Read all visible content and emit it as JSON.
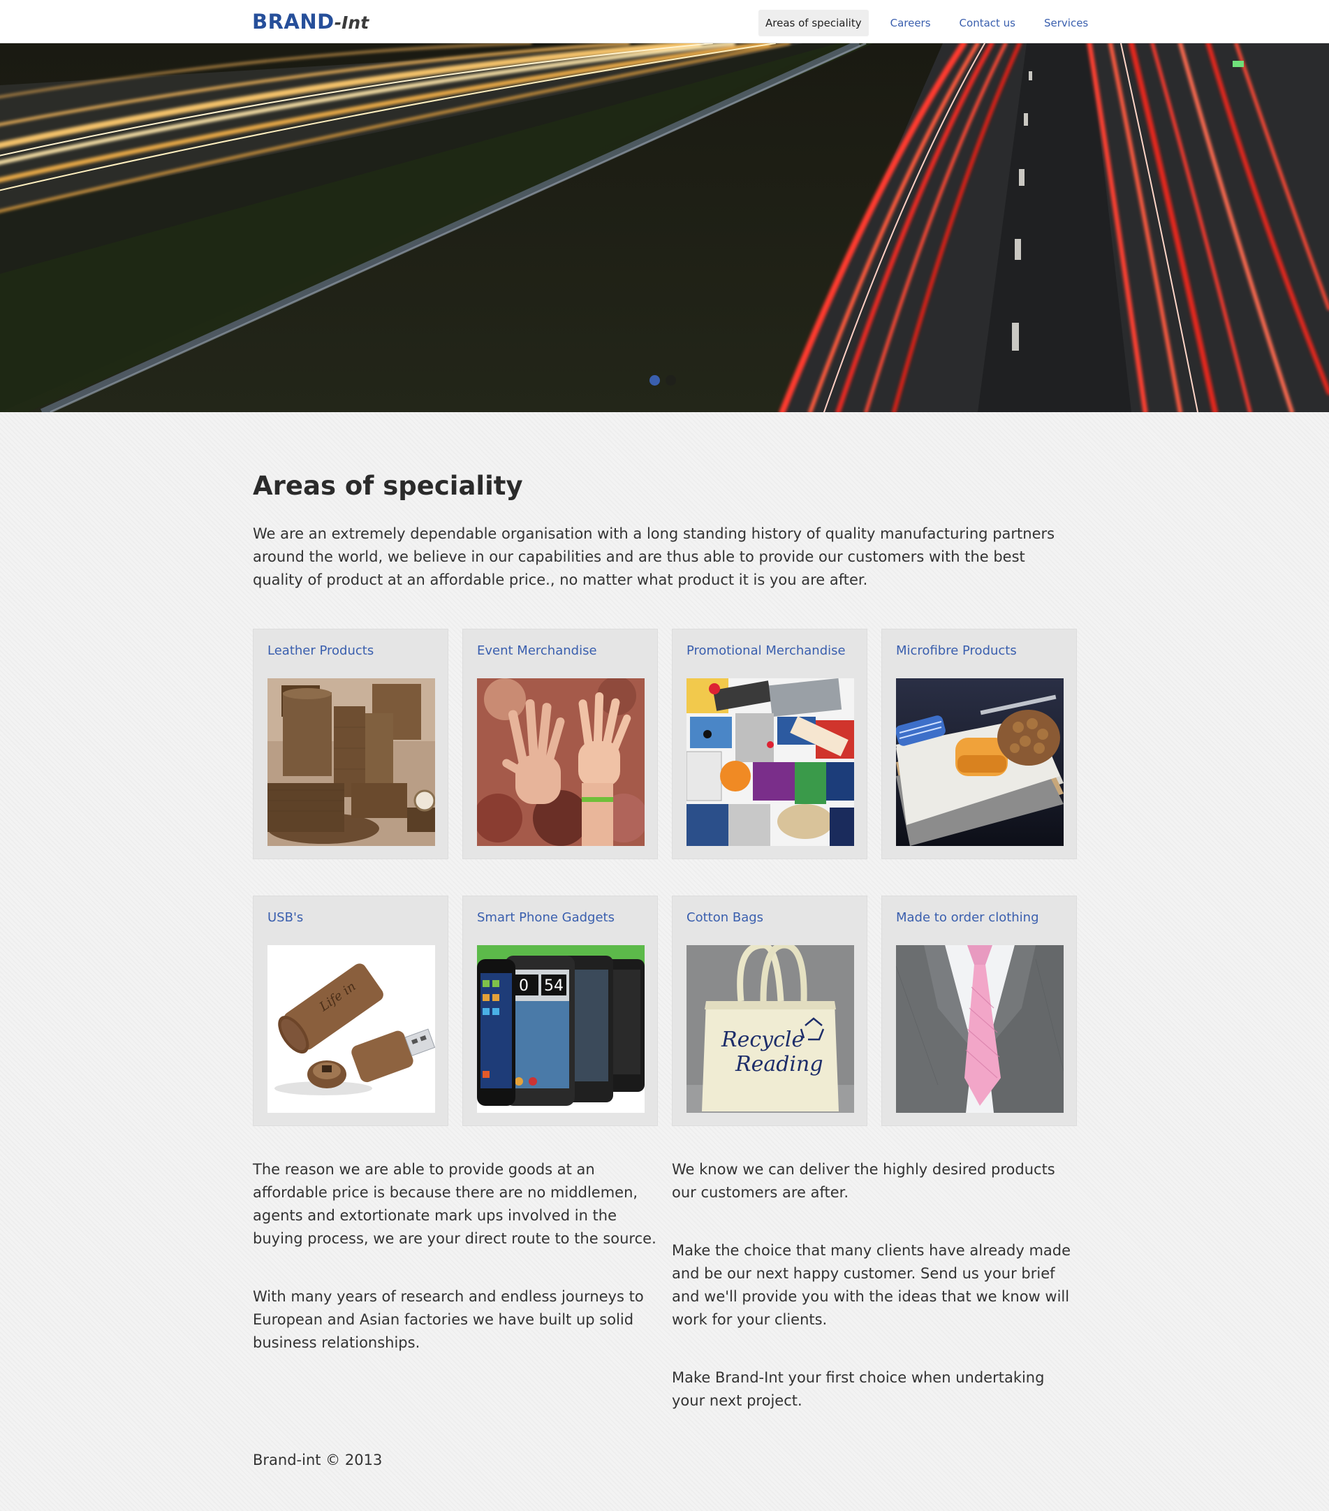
{
  "brand": {
    "main": "BRAND",
    "sub": "-Int"
  },
  "nav": {
    "items": [
      {
        "label": "Areas of speciality",
        "active": true
      },
      {
        "label": "Careers",
        "active": false
      },
      {
        "label": "Contact us",
        "active": false
      },
      {
        "label": "Services",
        "active": false
      }
    ]
  },
  "hero": {
    "slides_total": 2,
    "active_slide": 1
  },
  "main": {
    "title": "Areas of speciality",
    "intro": "We are an extremely dependable organisation with a long standing history of quality manufacturing partners around the world, we believe in our capabilities and are thus able to provide our customers with the best quality of product at an affordable price., no matter what product it is you are after."
  },
  "categories": [
    {
      "title": "Leather Products",
      "image": "leather-desk-set"
    },
    {
      "title": "Event Merchandise",
      "image": "crowd-hands"
    },
    {
      "title": "Promotional Merchandise",
      "image": "promo-items-collage"
    },
    {
      "title": "Microfibre Products",
      "image": "microfibre-cloths"
    },
    {
      "title": "USB's",
      "image": "cork-usb-drive"
    },
    {
      "title": "Smart Phone Gadgets",
      "image": "smartphones"
    },
    {
      "title": "Cotton Bags",
      "image": "cotton-tote-bag",
      "image_text_1": "Recycle",
      "image_text_2": "Reading"
    },
    {
      "title": "Made to order clothing",
      "image": "suit-and-tie"
    }
  ],
  "left_column": [
    "The reason we are able to provide goods at an affordable price is because there are no middlemen, agents and extortionate mark ups involved in the buying process, we are your direct route to the source.",
    "With many years of research and endless journeys to European and Asian factories we have built up solid business relationships."
  ],
  "right_column": [
    "We know we can deliver the highly desired products our customers are after.",
    "Make the choice that many clients have already made and be our next happy customer. Send us your brief and we'll provide you with the ideas that we know will work for your clients.",
    "Make Brand-Int your first choice when undertaking your next project."
  ],
  "footer": {
    "text": "Brand-int © 2013"
  },
  "colors": {
    "accent": "#3a5fae",
    "brand": "#264f9a",
    "page_bg": "#f3f3f3",
    "card_bg": "#e5e5e5"
  }
}
